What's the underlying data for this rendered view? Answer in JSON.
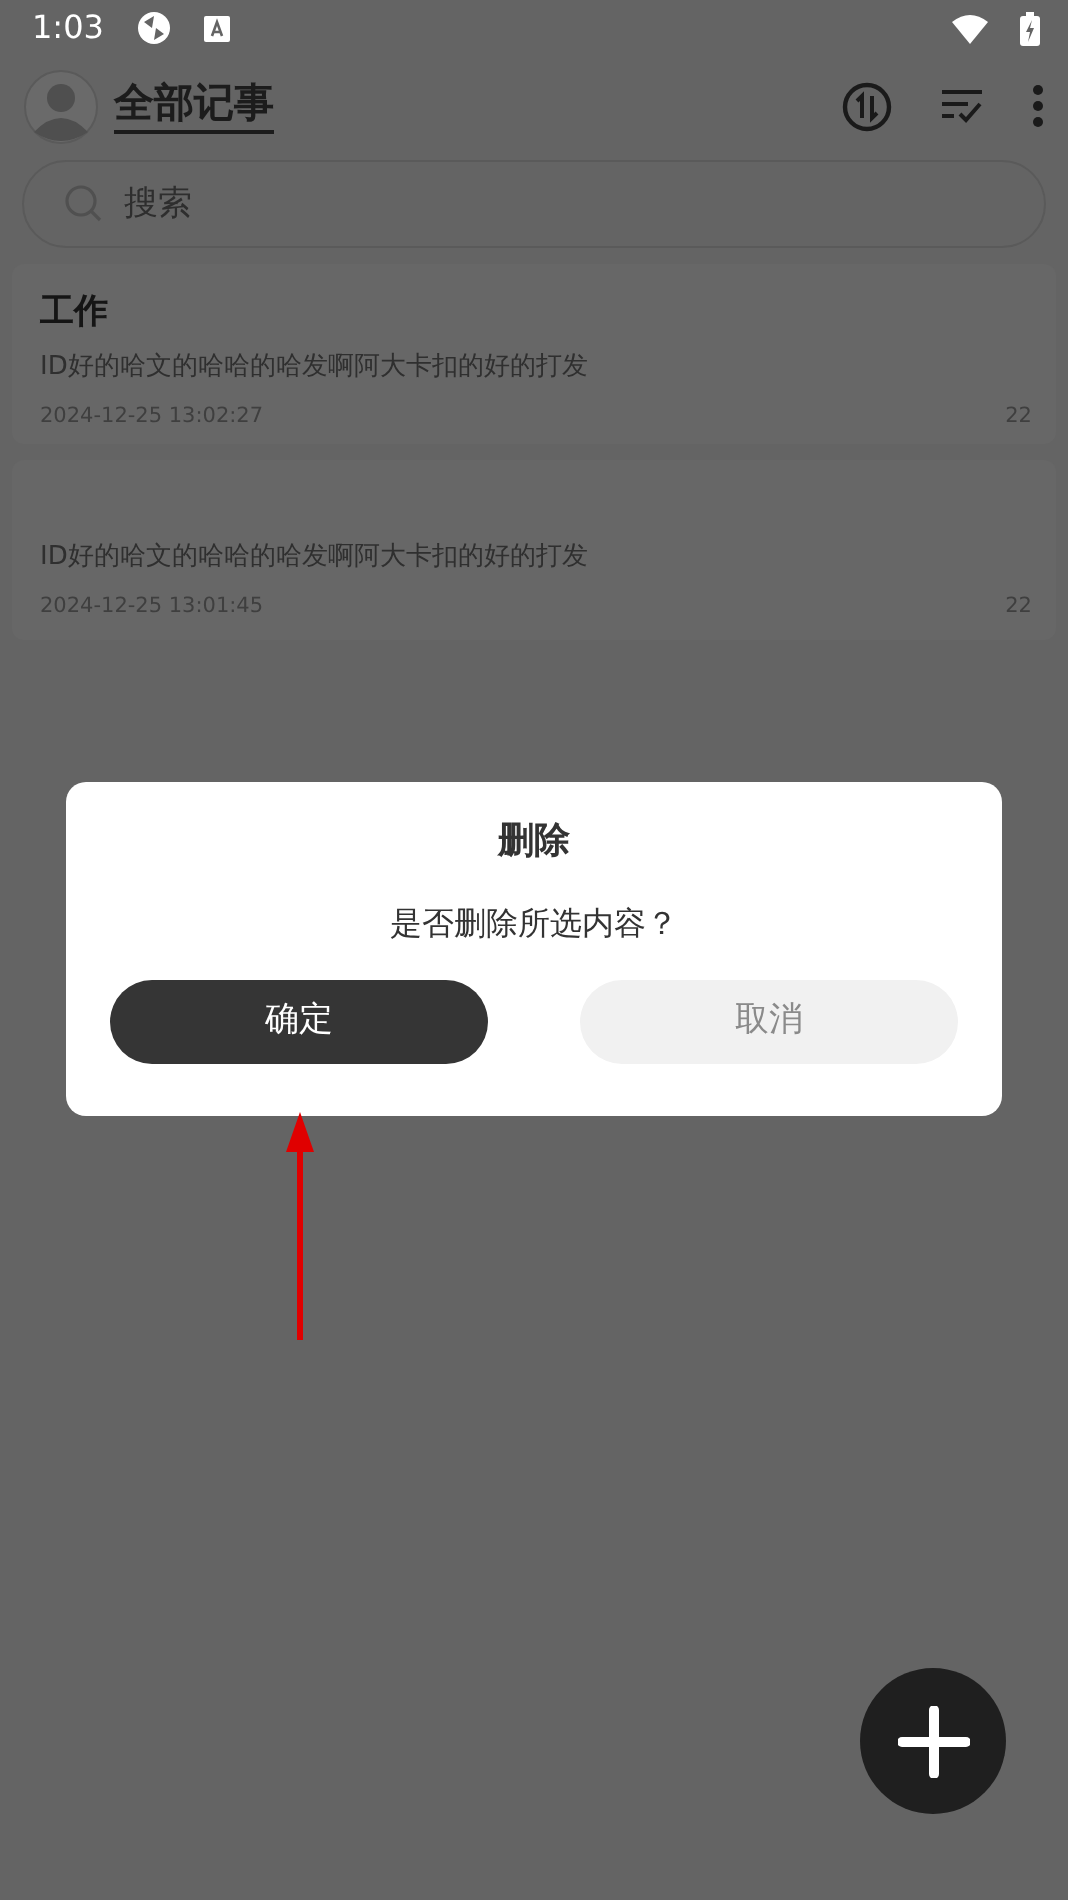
{
  "status_bar": {
    "time": "1:03"
  },
  "header": {
    "title": "全部记事"
  },
  "search": {
    "placeholder": "搜索"
  },
  "notes": [
    {
      "title": "工作",
      "body": "ID好的哈文的哈哈的哈发啊阿大卡扣的好的打发",
      "time": "2024-12-25 13:02:27",
      "count": "22"
    },
    {
      "body": "ID好的哈文的哈哈的哈发啊阿大卡扣的好的打发",
      "time": "2024-12-25 13:01:45",
      "count": "22"
    }
  ],
  "dialog": {
    "title": "删除",
    "message": "是否删除所选内容？",
    "buttons": [
      {
        "label": "确定",
        "kind": "primary"
      },
      {
        "label": "取消",
        "kind": "secondary"
      }
    ]
  }
}
